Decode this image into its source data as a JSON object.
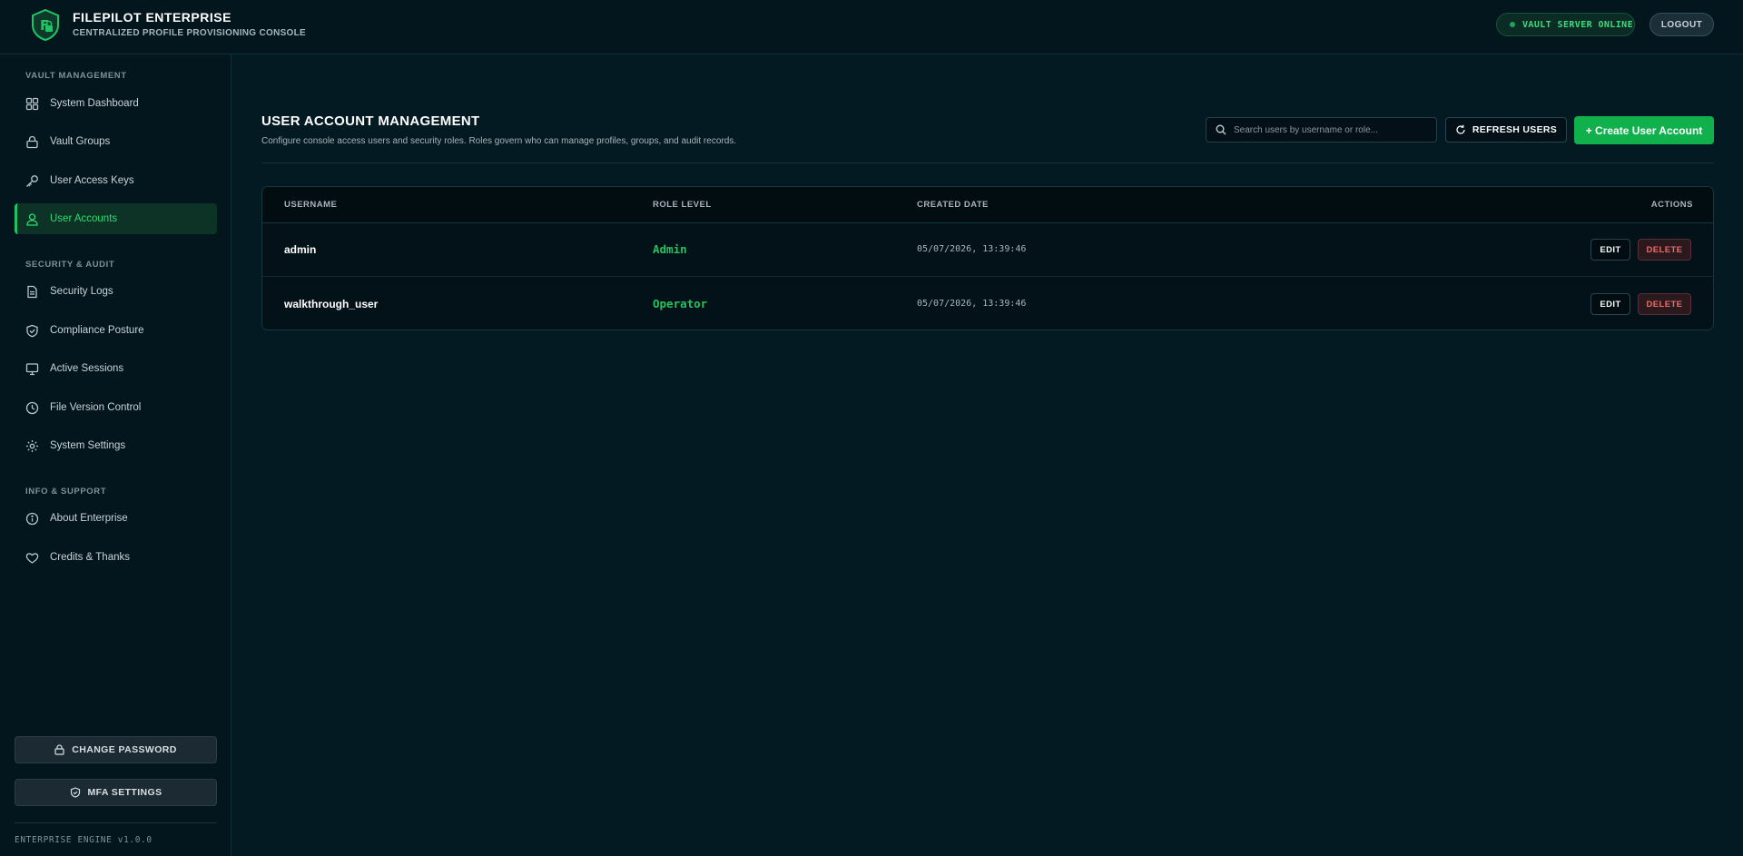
{
  "header": {
    "title": "FILEPILOT ENTERPRISE",
    "subtitle": "CENTRALIZED PROFILE PROVISIONING CONSOLE",
    "status": "VAULT SERVER ONLINE",
    "logout_label": "LOGOUT"
  },
  "sidebar": {
    "sections": [
      {
        "label": "VAULT MANAGEMENT",
        "items": [
          {
            "label": "System Dashboard",
            "icon": "grid-icon"
          },
          {
            "label": "Vault Groups",
            "icon": "lock-icon"
          },
          {
            "label": "User Access Keys",
            "icon": "key-icon"
          },
          {
            "label": "User Accounts",
            "icon": "users-icon",
            "active": true
          }
        ]
      },
      {
        "label": "SECURITY & AUDIT",
        "items": [
          {
            "label": "Security Logs",
            "icon": "document-icon"
          },
          {
            "label": "Compliance Posture",
            "icon": "shield-check-icon"
          },
          {
            "label": "Active Sessions",
            "icon": "monitor-icon"
          },
          {
            "label": "File Version Control",
            "icon": "clock-icon"
          },
          {
            "label": "System Settings",
            "icon": "gear-icon"
          }
        ]
      },
      {
        "label": "INFO & SUPPORT",
        "items": [
          {
            "label": "About Enterprise",
            "icon": "info-icon"
          },
          {
            "label": "Credits & Thanks",
            "icon": "heart-icon"
          }
        ]
      }
    ],
    "change_password_label": "CHANGE PASSWORD",
    "mfa_settings_label": "MFA SETTINGS",
    "version": "ENTERPRISE ENGINE v1.0.0"
  },
  "main": {
    "title": "USER ACCOUNT MANAGEMENT",
    "description": "Configure console access users and security roles. Roles govern who can manage profiles, groups, and audit records.",
    "search_placeholder": "Search users by username or role...",
    "refresh_label": "REFRESH USERS",
    "create_label": "+ Create User Account",
    "table": {
      "columns": [
        "USERNAME",
        "ROLE LEVEL",
        "CREATED DATE",
        "ACTIONS"
      ],
      "rows": [
        {
          "username": "admin",
          "role": "Admin",
          "created": "05/07/2026, 13:39:46",
          "edit": "EDIT",
          "delete": "DELETE"
        },
        {
          "username": "walkthrough_user",
          "role": "Operator",
          "created": "05/07/2026, 13:39:46",
          "edit": "EDIT",
          "delete": "DELETE"
        }
      ]
    }
  },
  "colors": {
    "accent": "#10b04d",
    "accent_text": "#22c35f",
    "danger": "#f06a6a",
    "background": "#031a22"
  }
}
